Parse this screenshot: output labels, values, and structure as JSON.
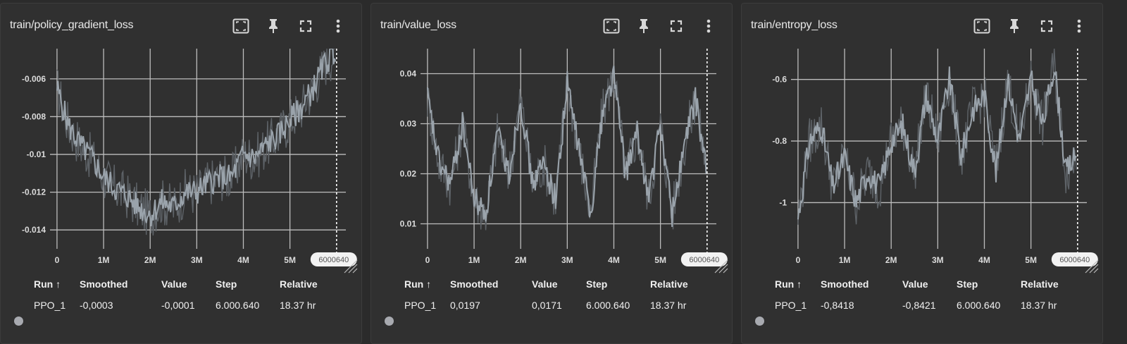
{
  "table_headers": {
    "run": "Run ↑",
    "smoothed": "Smoothed",
    "value": "Value",
    "step": "Step",
    "relative": "Relative"
  },
  "icons": [
    "fit-domain-icon",
    "pin-icon",
    "fullscreen-icon",
    "more-vert-icon"
  ],
  "colors": {
    "line": "#9aa3ab",
    "line_raw": "#5e6368",
    "grid": "#bdbdbd",
    "run_dot": "#a8aab0"
  },
  "charts": [
    {
      "title": "train/policy_gradient_loss",
      "row": {
        "run": "PPO_1",
        "smoothed": "-0,0003",
        "value": "-0,0001",
        "step": "6.000.640",
        "relative": "18.37 hr"
      },
      "step_badge": "6000640"
    },
    {
      "title": "train/value_loss",
      "row": {
        "run": "PPO_1",
        "smoothed": "0,0197",
        "value": "0,0171",
        "step": "6.000.640",
        "relative": "18.37 hr"
      },
      "step_badge": "6000640"
    },
    {
      "title": "train/entropy_loss",
      "row": {
        "run": "PPO_1",
        "smoothed": "-0,8418",
        "value": "-0,8421",
        "step": "6.000.640",
        "relative": "18.37 hr"
      },
      "step_badge": "6000640"
    }
  ],
  "chart_data": [
    {
      "type": "line",
      "title": "train/policy_gradient_loss",
      "x_ticks": [
        "0",
        "1M",
        "2M",
        "3M",
        "4M",
        "5M"
      ],
      "y_ticks": [
        "-0.006",
        "-0.008",
        "-0.01",
        "-0.012",
        "-0.014"
      ],
      "y_tick_values": [
        -0.006,
        -0.008,
        -0.01,
        -0.012,
        -0.014
      ],
      "xlim": [
        -150000,
        6200000
      ],
      "ylim": [
        -0.015,
        -0.0044
      ],
      "series": [
        {
          "x": [
            0,
            250000,
            500000,
            750000,
            1000000,
            1250000,
            1500000,
            1750000,
            2000000,
            2250000,
            2500000,
            2750000,
            3000000,
            3250000,
            3500000,
            3750000,
            4000000,
            4250000,
            4500000,
            4750000,
            5000000,
            5250000,
            5500000,
            5750000,
            6000000
          ],
          "values": [
            -0.0065,
            -0.0085,
            -0.0095,
            -0.0102,
            -0.0112,
            -0.0118,
            -0.0122,
            -0.0128,
            -0.0132,
            -0.0125,
            -0.0128,
            -0.012,
            -0.012,
            -0.0115,
            -0.0112,
            -0.0112,
            -0.01,
            -0.0102,
            -0.0095,
            -0.009,
            -0.0082,
            -0.0075,
            -0.0065,
            -0.0052,
            -0.0045
          ]
        }
      ]
    },
    {
      "type": "line",
      "title": "train/value_loss",
      "x_ticks": [
        "0",
        "1M",
        "2M",
        "3M",
        "4M",
        "5M"
      ],
      "y_ticks": [
        "0.04",
        "0.03",
        "0.02",
        "0.01"
      ],
      "y_tick_values": [
        0.04,
        0.03,
        0.02,
        0.01
      ],
      "xlim": [
        -150000,
        6200000
      ],
      "ylim": [
        0.005,
        0.045
      ],
      "series": [
        {
          "x": [
            0,
            250000,
            500000,
            750000,
            1000000,
            1250000,
            1500000,
            1750000,
            2000000,
            2250000,
            2500000,
            2750000,
            3000000,
            3250000,
            3500000,
            3750000,
            4000000,
            4250000,
            4500000,
            4750000,
            5000000,
            5250000,
            5500000,
            5750000,
            6000000
          ],
          "values": [
            0.035,
            0.022,
            0.018,
            0.03,
            0.015,
            0.012,
            0.028,
            0.02,
            0.035,
            0.018,
            0.022,
            0.015,
            0.038,
            0.025,
            0.012,
            0.032,
            0.04,
            0.02,
            0.028,
            0.015,
            0.03,
            0.012,
            0.025,
            0.035,
            0.02
          ]
        }
      ]
    },
    {
      "type": "line",
      "title": "train/entropy_loss",
      "x_ticks": [
        "0",
        "1M",
        "2M",
        "3M",
        "4M",
        "5M"
      ],
      "y_ticks": [
        "-0.6",
        "-0.8",
        "-1"
      ],
      "y_tick_values": [
        -0.6,
        -0.8,
        -1
      ],
      "xlim": [
        -150000,
        6200000
      ],
      "ylim": [
        -1.15,
        -0.5
      ],
      "series": [
        {
          "x": [
            0,
            250000,
            500000,
            750000,
            1000000,
            1250000,
            1500000,
            1750000,
            2000000,
            2250000,
            2500000,
            2750000,
            3000000,
            3250000,
            3500000,
            3750000,
            4000000,
            4250000,
            4500000,
            4750000,
            5000000,
            5250000,
            5500000,
            5750000,
            6000000
          ],
          "values": [
            -1.05,
            -0.8,
            -0.75,
            -0.95,
            -0.85,
            -1.0,
            -0.9,
            -0.95,
            -0.8,
            -0.75,
            -0.9,
            -0.65,
            -0.8,
            -0.6,
            -0.85,
            -0.7,
            -0.65,
            -0.9,
            -0.6,
            -0.8,
            -0.6,
            -0.75,
            -0.55,
            -0.9,
            -0.84
          ]
        }
      ]
    }
  ]
}
